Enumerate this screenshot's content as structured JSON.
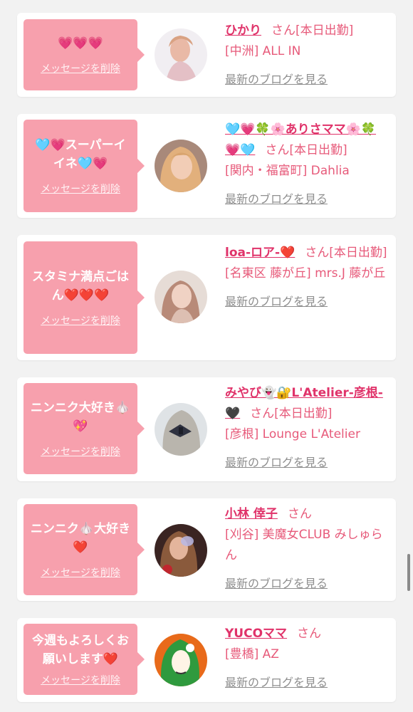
{
  "delete_label": "メッセージを削除",
  "san_label": "さん",
  "blog_label": "最新のブログを見る",
  "colors": {
    "bubble": "#f7a0ad",
    "name": "#e0336a",
    "info": "#e75a7a",
    "blog": "#8f8f8f",
    "background": "#f2f2f2"
  },
  "cards": [
    {
      "message": "💗💗💗",
      "name": "ひかり",
      "status": "[本日出勤]",
      "location": "[中洲] ALL IN",
      "avatar": "avatar-pale-portrait"
    },
    {
      "message": "🩵💗スーパーイイネ🩵💗",
      "name": "🩵💗🍀🌸ありさママ🌸🍀💗🩵",
      "status": "[本日出勤]",
      "location": "[関内・福富町] Dahlia",
      "avatar": "avatar-blonde-portrait"
    },
    {
      "message": "スタミナ満点ごはん❤️❤️❤️",
      "name": "loa-ロア-❤️",
      "status": "[本日出勤]",
      "location": "[名東区 藤が丘] mrs.J 藤が丘",
      "avatar": "avatar-selfie-portrait"
    },
    {
      "message": "ニンニク大好き🧄💖",
      "name": "みやび👻🔐L'Atelier-彦根-🖤",
      "status": "[本日出勤]",
      "location": "[彦根] Lounge L'Atelier",
      "avatar": "avatar-hair-ribbon"
    },
    {
      "message": "ニンニク🧄大好き❤️",
      "name": "小林 倖子",
      "status": "",
      "location": "[刈谷] 美魔女CLUB みしゅらん",
      "avatar": "avatar-dark-portrait"
    },
    {
      "message": "今週もよろしくお願いします❤️",
      "name": "YUCOママ",
      "status": "",
      "location": "[豊橋] AZ",
      "avatar": "avatar-green-hair-illustration"
    }
  ]
}
